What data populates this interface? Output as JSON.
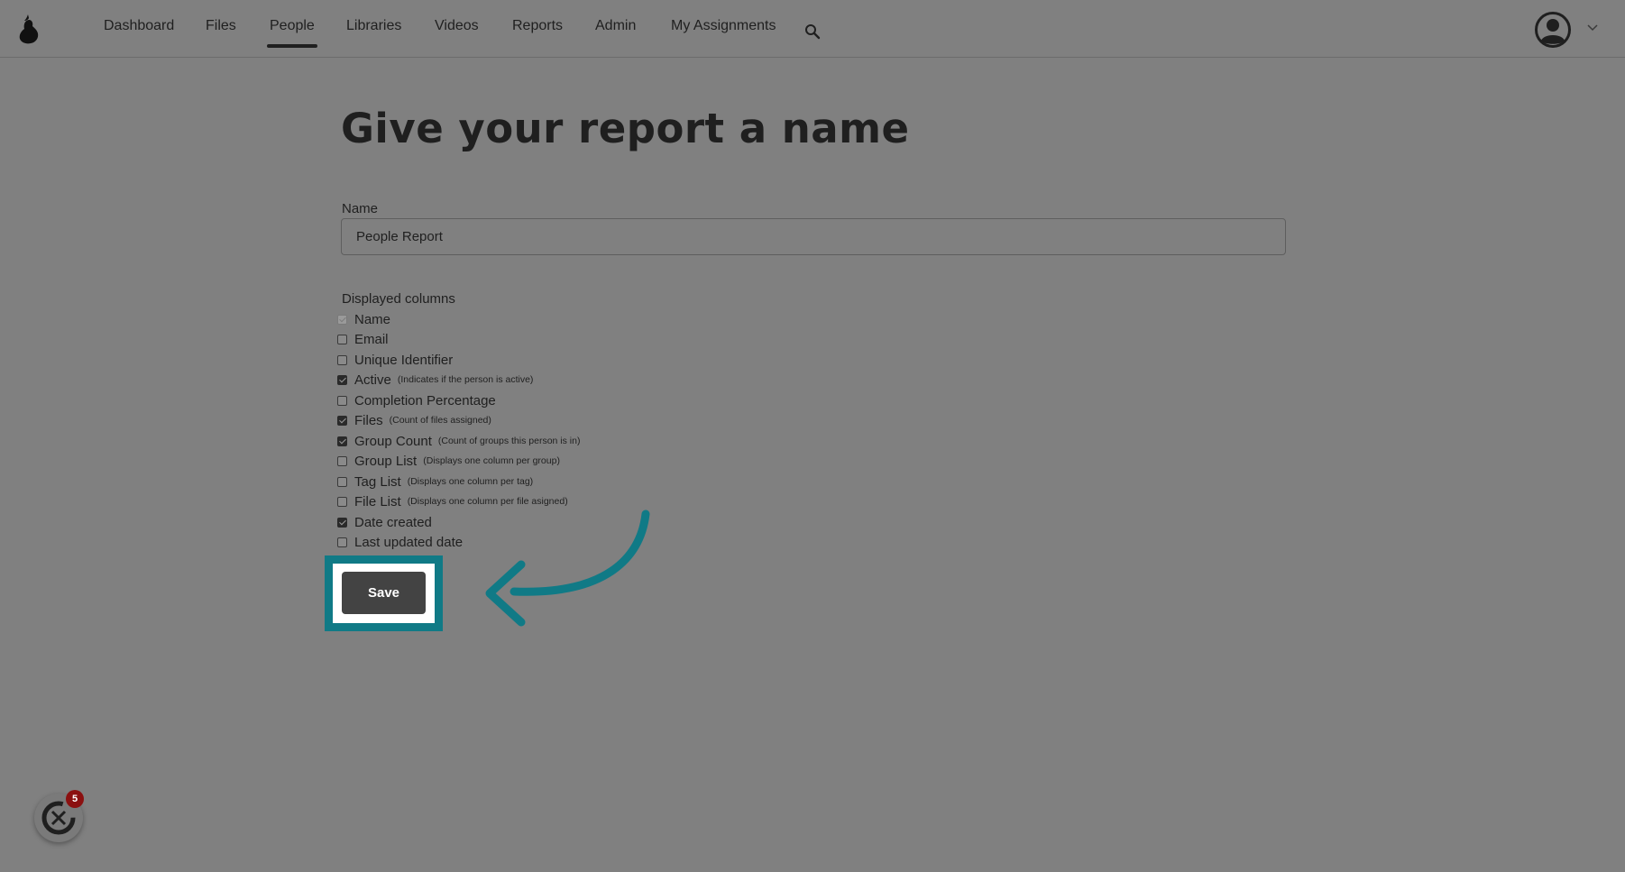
{
  "nav": {
    "items": [
      {
        "label": "Dashboard",
        "active": false
      },
      {
        "label": "Files",
        "active": false
      },
      {
        "label": "People",
        "active": true
      },
      {
        "label": "Libraries",
        "active": false
      },
      {
        "label": "Videos",
        "active": false
      },
      {
        "label": "Reports",
        "active": false
      },
      {
        "label": "Admin",
        "active": false
      },
      {
        "label": "My Assignments",
        "active": false
      }
    ],
    "search_icon": "search-icon",
    "avatar_icon": "user-avatar-icon",
    "caret_icon": "chevron-down-icon"
  },
  "main": {
    "heading": "Give your report a name",
    "name_label": "Name",
    "name_value": "People Report",
    "columns_label": "Displayed columns",
    "columns": [
      {
        "label": "Name",
        "hint": "",
        "checked": true,
        "disabled": true
      },
      {
        "label": "Email",
        "hint": "",
        "checked": false,
        "disabled": false
      },
      {
        "label": "Unique Identifier",
        "hint": "",
        "checked": false,
        "disabled": false
      },
      {
        "label": "Active",
        "hint": "(Indicates if the person is active)",
        "checked": true,
        "disabled": false
      },
      {
        "label": "Completion Percentage",
        "hint": "",
        "checked": false,
        "disabled": false
      },
      {
        "label": "Files",
        "hint": "(Count of files assigned)",
        "checked": true,
        "disabled": false
      },
      {
        "label": "Group Count",
        "hint": "(Count of groups this person is in)",
        "checked": true,
        "disabled": false
      },
      {
        "label": "Group List",
        "hint": "(Displays one column per group)",
        "checked": false,
        "disabled": false
      },
      {
        "label": "Tag List",
        "hint": "(Displays one column per tag)",
        "checked": false,
        "disabled": false
      },
      {
        "label": "File List",
        "hint": "(Displays one column per file asigned)",
        "checked": false,
        "disabled": false
      },
      {
        "label": "Date created",
        "hint": "",
        "checked": true,
        "disabled": false
      },
      {
        "label": "Last updated date",
        "hint": "",
        "checked": false,
        "disabled": false
      }
    ],
    "save_label": "Save"
  },
  "chat_widget": {
    "badge_count": "5"
  },
  "colors": {
    "overlay_gray": "#808080",
    "highlight_teal": "#107a86",
    "save_button": "#434343",
    "badge_red": "#8b1010"
  }
}
